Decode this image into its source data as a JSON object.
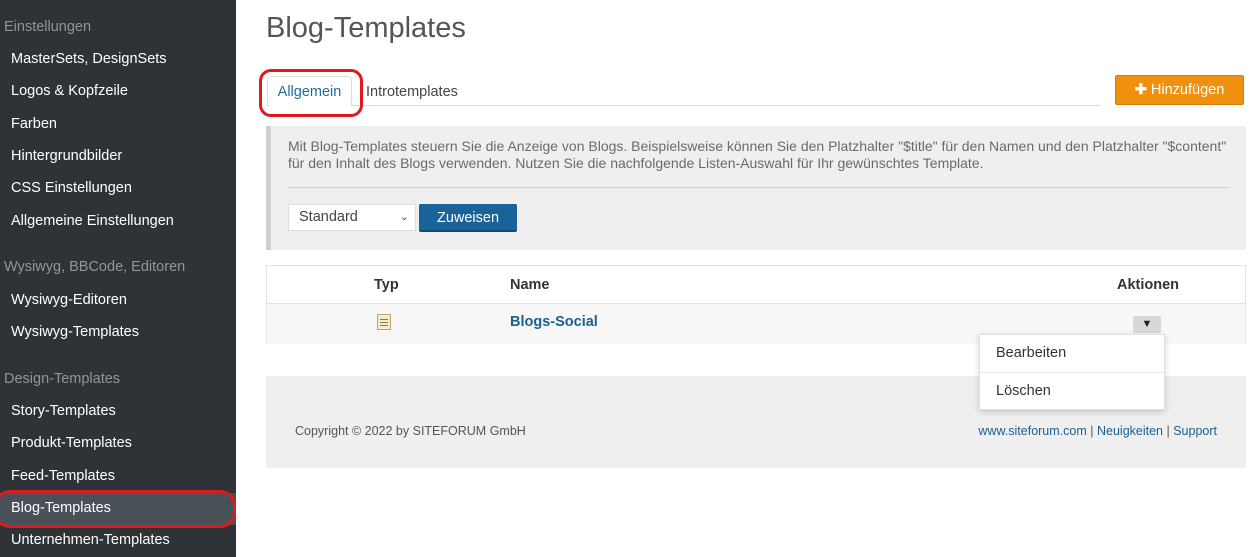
{
  "sidebar": {
    "sections": [
      {
        "title": "Einstellungen",
        "items": [
          "MasterSets, DesignSets",
          "Logos & Kopfzeile",
          "Farben",
          "Hintergrundbilder",
          "CSS Einstellungen",
          "Allgemeine Einstellungen"
        ]
      },
      {
        "title": "Wysiwyg, BBCode, Editoren",
        "items": [
          "Wysiwyg-Editoren",
          "Wysiwyg-Templates"
        ]
      },
      {
        "title": "Design-Templates",
        "items": [
          "Story-Templates",
          "Produkt-Templates",
          "Feed-Templates",
          "Blog-Templates",
          "Unternehmen-Templates"
        ]
      }
    ],
    "active_item": "Blog-Templates"
  },
  "header": {
    "title": "Blog-Templates"
  },
  "tabs": [
    {
      "label": "Allgemein",
      "active": true
    },
    {
      "label": "Introtemplates",
      "active": false
    }
  ],
  "add_button": {
    "label": "Hinzufügen",
    "icon": "plus-icon"
  },
  "info": {
    "text": "Mit Blog-Templates steuern Sie die Anzeige von Blogs. Beispielsweise können Sie den Platzhalter \"$title\" für den Namen und den Platzhalter \"$content\" für den Inhalt des Blogs verwenden. Nutzen Sie die nachfolgende Listen-Auswahl für Ihr gewünschtes Template."
  },
  "template_select": {
    "value": "Standard"
  },
  "assign_button": {
    "label": "Zuweisen"
  },
  "table": {
    "columns": [
      "Typ",
      "Name",
      "Aktionen"
    ],
    "rows": [
      {
        "type_icon": "document-icon",
        "name": "Blogs-Social"
      }
    ]
  },
  "actions_menu": {
    "items": [
      "Bearbeiten",
      "Löschen"
    ]
  },
  "footer": {
    "copyright": "Copyright © 2022 by SITEFORUM GmbH",
    "links": [
      "www.siteforum.com",
      "Neuigkeiten",
      "Support"
    ],
    "separator": "|"
  },
  "colors": {
    "sidebar_bg": "#2e3338",
    "accent_blue": "#1a6398",
    "add_orange": "#f0900f",
    "highlight_red": "#e0191f"
  }
}
